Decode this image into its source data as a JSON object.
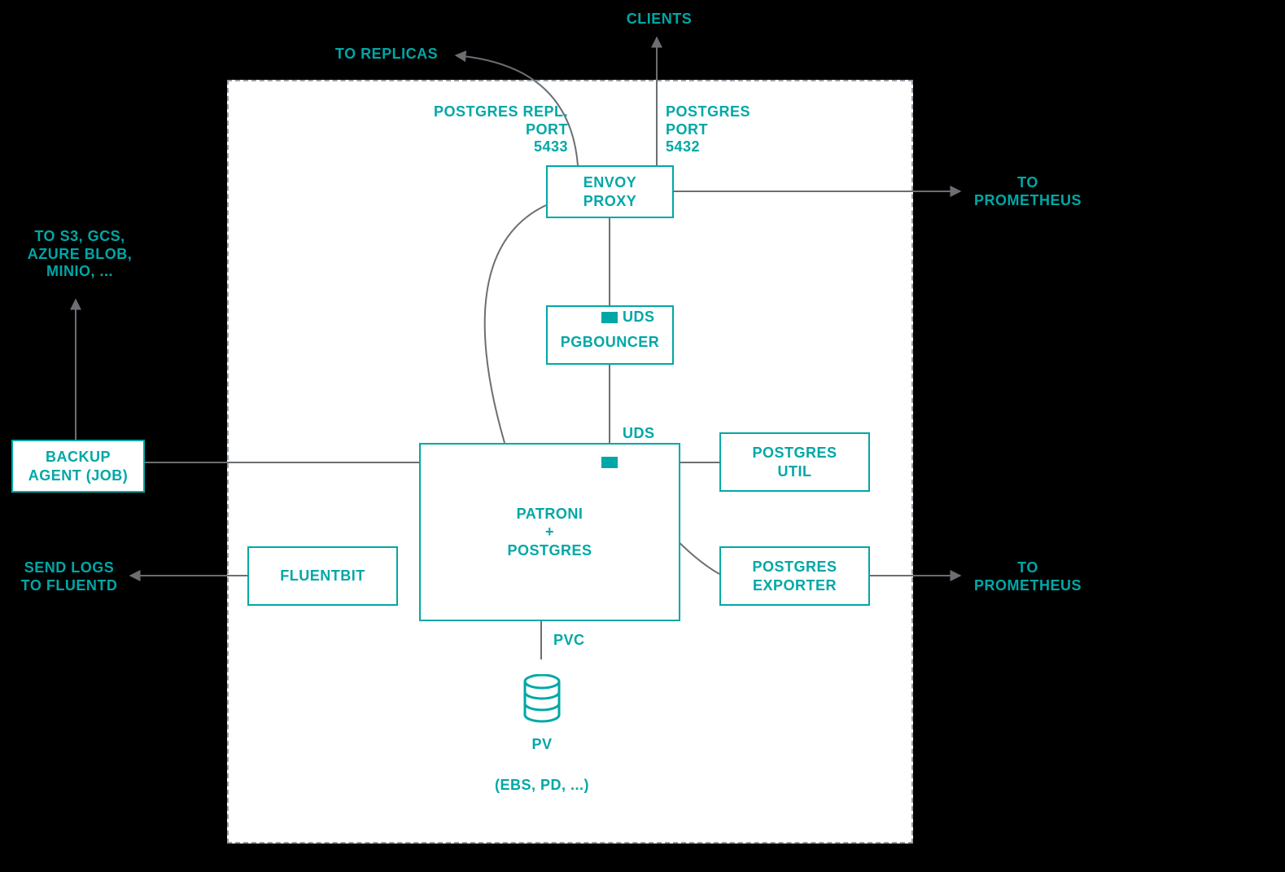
{
  "external": {
    "clients": "CLIENTS",
    "to_replicas": "TO REPLICAS",
    "to_prometheus_1": "TO\nPROMETHEUS",
    "to_prometheus_2": "TO\nPROMETHEUS",
    "send_logs_to_fluentd": "SEND LOGS\nTO FLUENTD",
    "to_s3": "TO S3, GCS,\nAZURE BLOB,\nMINIO, ..."
  },
  "ports": {
    "repl_port": "POSTGRES REPL. PORT\n5433",
    "pg_port": "POSTGRES PORT\n5432"
  },
  "boxes": {
    "envoy": "ENVOY\nPROXY",
    "pgbouncer": "PGBOUNCER",
    "patroni": "PATRONI\n+\nPOSTGRES",
    "pg_util": "POSTGRES\nUTIL",
    "pg_exporter": "POSTGRES\nEXPORTER",
    "fluentbit": "FLUENTBIT",
    "backup_agent": "BACKUP\nAGENT (JOB)"
  },
  "labels": {
    "uds1": "UDS",
    "uds2": "UDS",
    "pvc": "PVC",
    "pv": "PV",
    "pv_note": "(EBS, PD, ...)"
  }
}
